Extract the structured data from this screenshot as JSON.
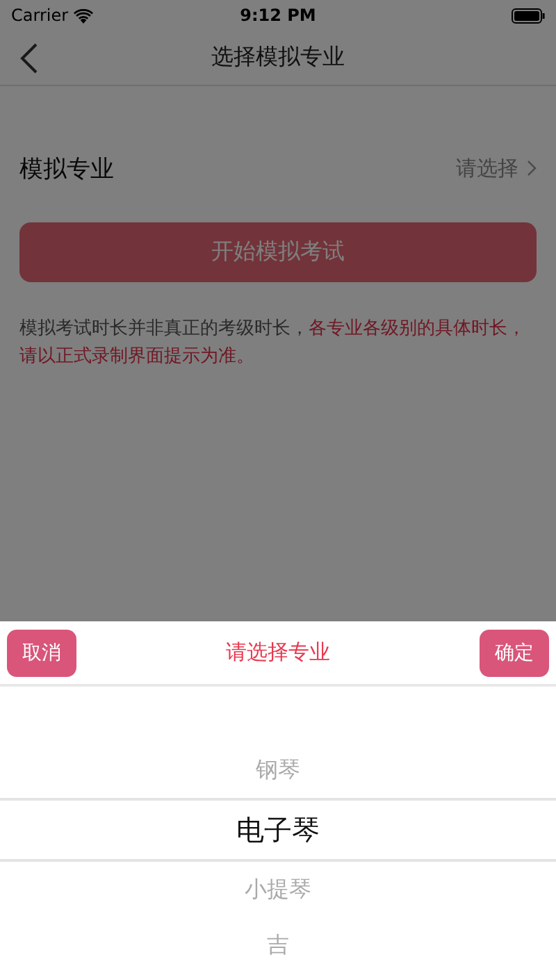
{
  "status_bar": {
    "carrier": "Carrier",
    "time": "9:12 PM"
  },
  "nav": {
    "title": "选择模拟专业"
  },
  "major_row": {
    "label": "模拟专业",
    "value": "请选择"
  },
  "start_button": {
    "label": "开始模拟考试"
  },
  "note": [
    {
      "kind": "normal",
      "text": "模拟考试时长并非真正的考级时长，"
    },
    {
      "kind": "highlight",
      "text": "各专业各级别的具体时长，请以正式录制界面提示为准。"
    }
  ],
  "picker": {
    "cancel": "取消",
    "title": "请选择专业",
    "confirm": "确定",
    "options": [
      {
        "label": "钢琴",
        "selected": false
      },
      {
        "label": "电子琴",
        "selected": true
      },
      {
        "label": "小提琴",
        "selected": false
      },
      {
        "label": "吉",
        "selected": false
      }
    ]
  }
}
